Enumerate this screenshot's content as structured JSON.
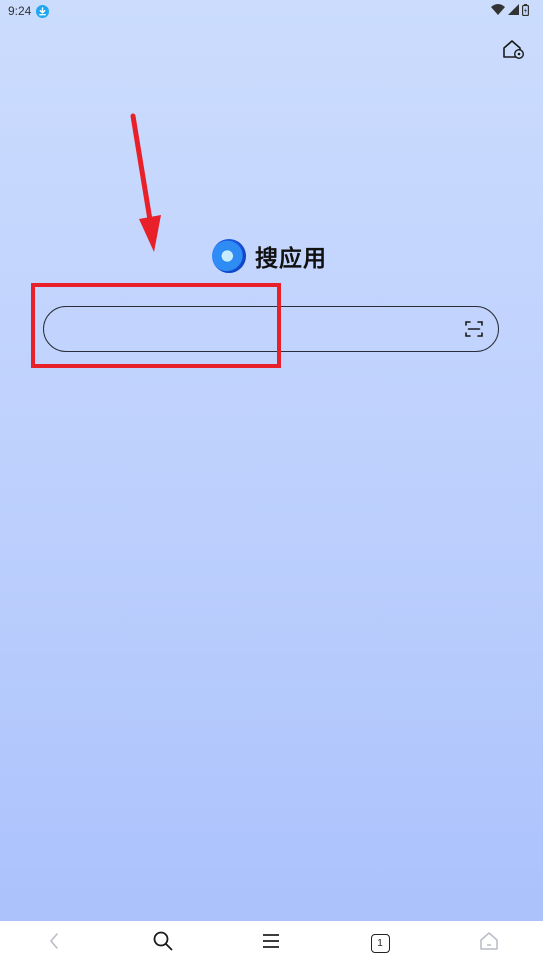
{
  "status_bar": {
    "time": "9:24",
    "icons": [
      "download-badge-icon",
      "wifi-icon",
      "signal-icon",
      "battery-icon"
    ]
  },
  "header": {
    "home_settings_icon": "home-settings-icon"
  },
  "logo": {
    "text": "搜应用",
    "icon": "app-logo-icon"
  },
  "search": {
    "value": "",
    "placeholder": "",
    "scan_icon": "scan-icon"
  },
  "annotation": {
    "color": "#e8202a"
  },
  "bottom_nav": {
    "items": [
      {
        "icon": "back-icon",
        "enabled": false
      },
      {
        "icon": "search-icon",
        "enabled": true
      },
      {
        "icon": "menu-icon",
        "enabled": true
      },
      {
        "icon": "tabs-icon",
        "enabled": true
      },
      {
        "icon": "home-icon",
        "enabled": false
      }
    ],
    "tab_count": "1"
  },
  "colors": {
    "bg_top": "#cbdcfd",
    "bg_bottom": "#a9c0fb",
    "accent": "#2f8cf5"
  }
}
